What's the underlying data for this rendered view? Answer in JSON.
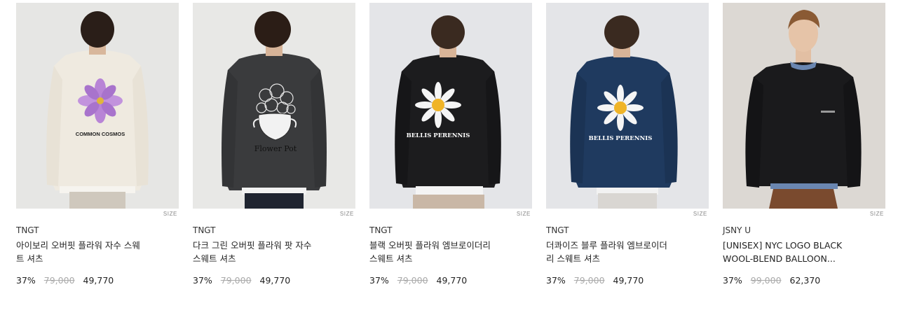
{
  "size_label": "SIZE",
  "products": [
    {
      "brand": "TNGT",
      "name": "아이보리 오버핏 플라워 자수 스웨\n트 셔츠",
      "discount": "37%",
      "original_price": "79,000",
      "sale_price": "49,770",
      "print_text": "COMMON COSMOS",
      "sweater_color": "#efeae0",
      "bg_color": "#e6e6e4"
    },
    {
      "brand": "TNGT",
      "name": "다크 그린 오버핏 플라워 팟 자수\n스웨트 셔츠",
      "discount": "37%",
      "original_price": "79,000",
      "sale_price": "49,770",
      "print_text": "Flower Pot",
      "sweater_color": "#3a3b3d",
      "bg_color": "#e8e8e6"
    },
    {
      "brand": "TNGT",
      "name": "블랙 오버핏 플라워 엠브로이더리\n스웨트 셔츠",
      "discount": "37%",
      "original_price": "79,000",
      "sale_price": "49,770",
      "print_text": "BELLIS PERENNIS",
      "sweater_color": "#1c1c1e",
      "bg_color": "#e4e5e8"
    },
    {
      "brand": "TNGT",
      "name": "더콰이즈 블루 플라워 엠브로이더\n리 스웨트 셔츠",
      "discount": "37%",
      "original_price": "79,000",
      "sale_price": "49,770",
      "print_text": "BELLIS PERENNIS",
      "sweater_color": "#1f3a5f",
      "bg_color": "#e4e5e8"
    },
    {
      "brand": "JSNY U",
      "name": "[UNISEX] NYC LOGO BLACK\nWOOL-BLEND BALLOON...",
      "discount": "37%",
      "original_price": "99,000",
      "sale_price": "62,370",
      "print_text": "",
      "sweater_color": "#1a1a1c",
      "bg_color": "#dcd8d3"
    }
  ]
}
